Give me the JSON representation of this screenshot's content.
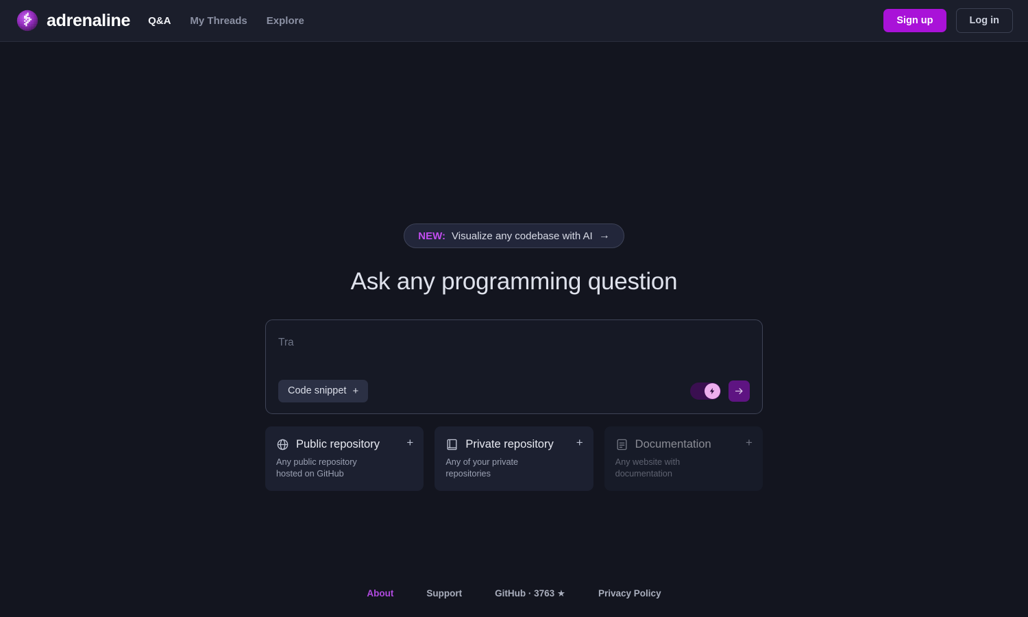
{
  "header": {
    "brand_name": "adrenaline",
    "logo_icon": "pixel-sphere-bolt-logo",
    "nav": [
      {
        "label": "Q&A",
        "active": true
      },
      {
        "label": "My Threads",
        "active": false
      },
      {
        "label": "Explore",
        "active": false
      }
    ],
    "signup_label": "Sign up",
    "login_label": "Log in",
    "accent_color": "#a912d8"
  },
  "banner": {
    "tag": "NEW:",
    "text": "Visualize any codebase with AI",
    "arrow": "→",
    "tag_color": "#c24df0"
  },
  "hero": {
    "title": "Ask any programming question"
  },
  "composer": {
    "value": "",
    "placeholder": "Tra",
    "code_snippet_label": "Code snippet",
    "code_snippet_plus": "+",
    "toggle": {
      "name": "turbo-mode-toggle",
      "state": "on",
      "icon": "lightning-bolt-icon",
      "track_color": "#3a0f50",
      "knob_color": "#edaeee"
    },
    "send": {
      "icon": "arrow-right-icon",
      "color": "#5e1482"
    }
  },
  "cards": [
    {
      "icon": "globe-icon",
      "title": "Public repository",
      "desc": "Any public repository hosted on GitHub",
      "plus": "+",
      "dim": false
    },
    {
      "icon": "book-icon",
      "title": "Private repository",
      "desc": "Any of your private repositories",
      "plus": "+",
      "dim": false
    },
    {
      "icon": "document-icon",
      "title": "Documentation",
      "desc": "Any website with documentation",
      "plus": "+",
      "dim": true
    }
  ],
  "footer": {
    "links": [
      {
        "label": "About",
        "accent": true
      },
      {
        "label": "Support",
        "accent": false
      },
      {
        "label": "GitHub · 3763 ★",
        "accent": false
      },
      {
        "label": "Privacy Policy",
        "accent": false
      }
    ]
  }
}
